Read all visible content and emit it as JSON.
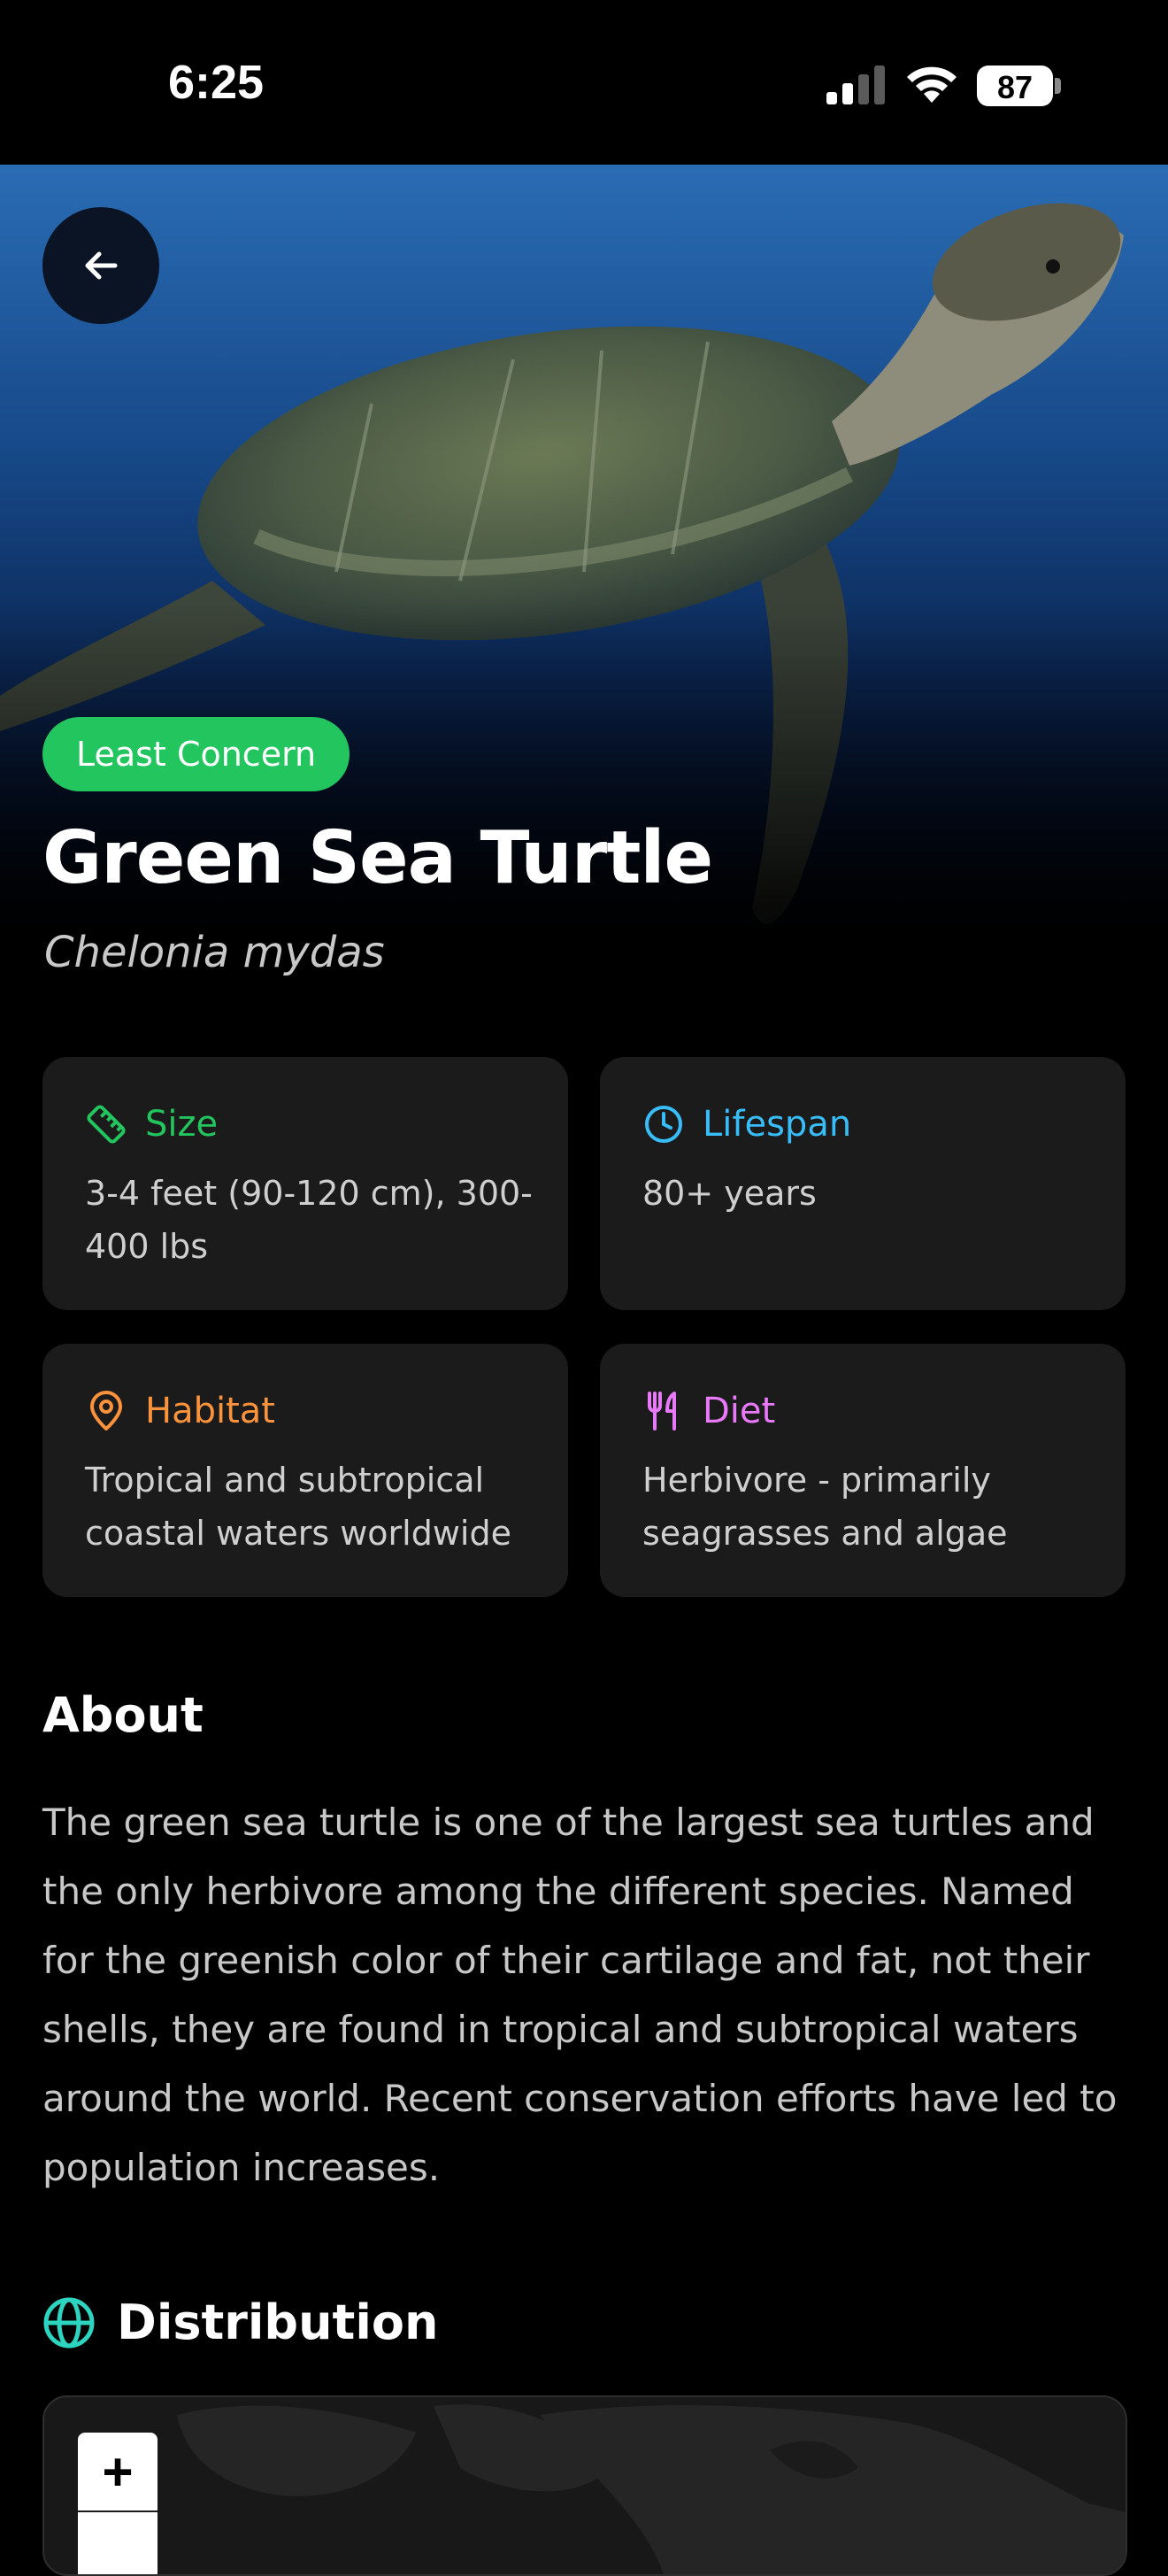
{
  "status_bar": {
    "time": "6:25",
    "battery": "87"
  },
  "hero": {
    "status_badge": "Least Concern",
    "title": "Green Sea Turtle",
    "scientific_name": "Chelonia mydas",
    "badge_color": "#22c55e"
  },
  "info_cards": [
    {
      "label": "Size",
      "value": "3-4 feet (90-120 cm), 300-400 lbs",
      "icon": "ruler-icon",
      "color": "#22c55e"
    },
    {
      "label": "Lifespan",
      "value": "80+ years",
      "icon": "clock-icon",
      "color": "#38bdf8"
    },
    {
      "label": "Habitat",
      "value": "Tropical and subtropical coastal waters worldwide",
      "icon": "location-pin-icon",
      "color": "#fb923c"
    },
    {
      "label": "Diet",
      "value": "Herbivore - primarily seagrasses and algae",
      "icon": "utensils-icon",
      "color": "#e879f9"
    }
  ],
  "about": {
    "heading": "About",
    "body": "The green sea turtle is one of the largest sea turtles and the only herbivore among the different species. Named for the greenish color of their cartilage and fat, not their shells, they are found in tropical and subtropical waters around the world. Recent conservation efforts have led to population increases."
  },
  "distribution": {
    "heading": "Distribution",
    "icon": "globe-icon",
    "zoom_in": "+"
  }
}
